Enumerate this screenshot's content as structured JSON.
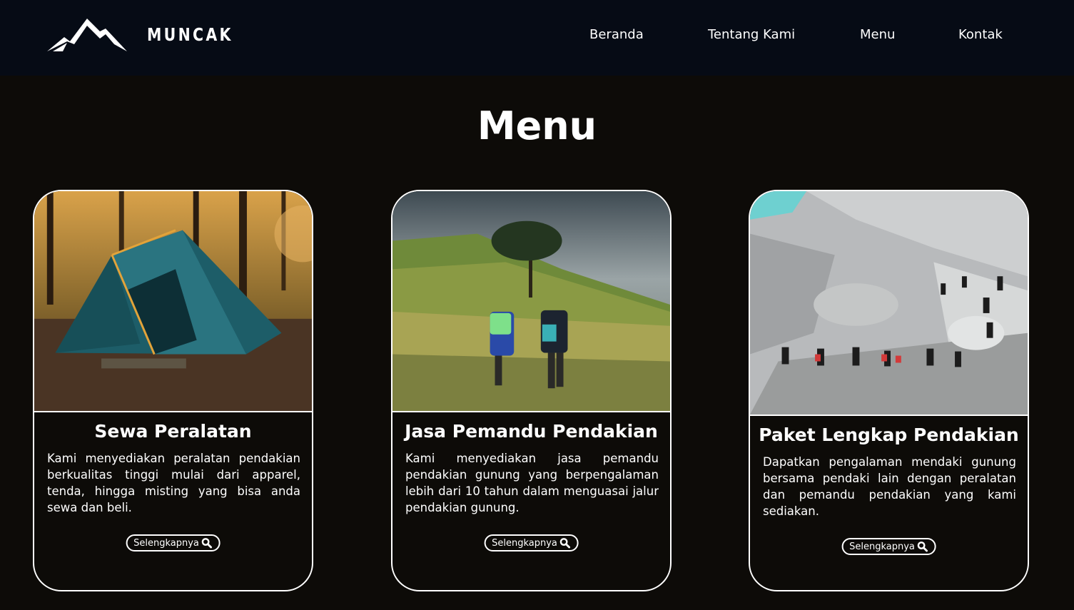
{
  "header": {
    "brand_name": "MUNCAK",
    "nav": [
      "Beranda",
      "Tentang Kami",
      "Menu",
      "Kontak"
    ]
  },
  "section": {
    "title": "Menu"
  },
  "cards": [
    {
      "title": "Sewa Peralatan",
      "description": "Kami menyediakan peralatan pendakian berkualitas tinggi mulai dari apparel, tenda, hingga misting yang bisa anda sewa dan beli.",
      "button": "Selengkapnya",
      "image": "camping-tent-in-forest"
    },
    {
      "title": "Jasa Pemandu Pendakian",
      "description": "Kami menyediakan jasa pemandu pendakian gunung yang berpengalaman lebih dari 10 tahun dalam menguasai jalur pendakian gunung.",
      "button": "Selengkapnya",
      "image": "hikers-on-grassy-hill"
    },
    {
      "title": "Paket Lengkap Pendakian",
      "description": "Dapatkan pengalaman mendaki gunung bersama pendaki lain dengan peralatan dan pemandu pendakian yang kami sediakan.",
      "button": "Selengkapnya",
      "image": "hikers-on-volcanic-rocks"
    }
  ],
  "colors": {
    "navbar": "#060b15",
    "background": "#0d0b08",
    "text": "#ffffff"
  },
  "icons": {
    "brand_logo": "mountain-logo-icon",
    "button_icon": "search-icon"
  }
}
